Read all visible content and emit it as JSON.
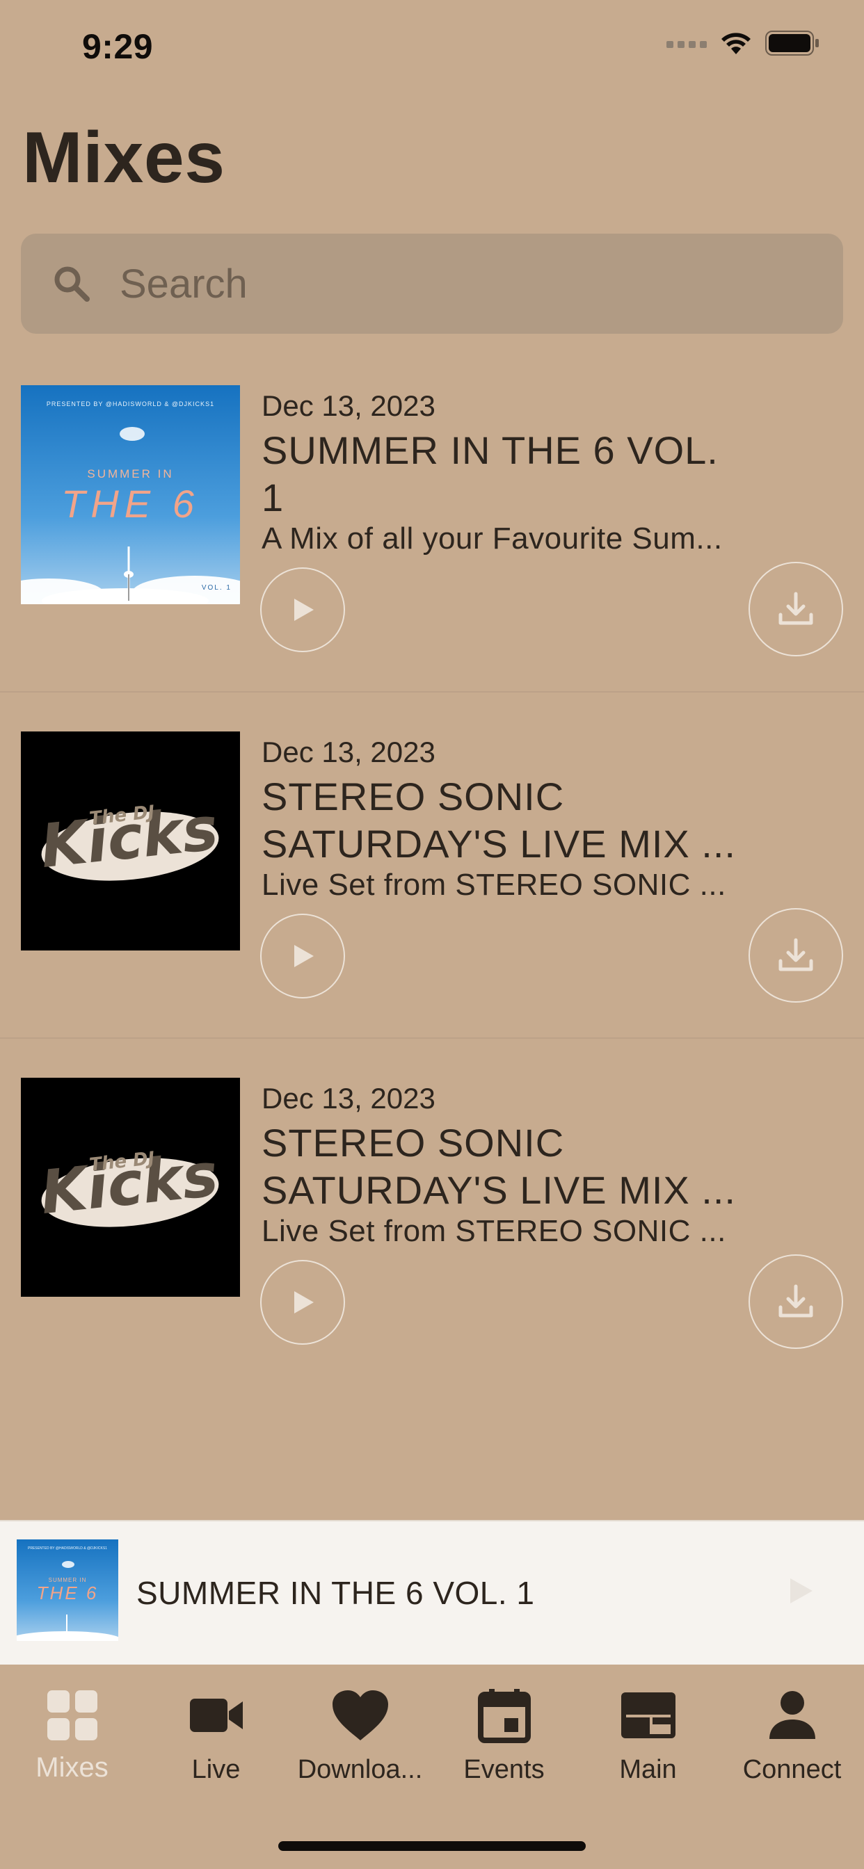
{
  "status_bar": {
    "time": "9:29"
  },
  "page_title": "Mixes",
  "search": {
    "placeholder": "Search"
  },
  "mixes": [
    {
      "date": "Dec 13, 2023",
      "title": "SUMMER IN THE 6 VOL. 1",
      "description": "A Mix of all your Favourite Sum...",
      "cover": {
        "type": "summer",
        "top_text": "PRESENTED BY @HADISWORLD & @DJKICKS1",
        "line1": "SUMMER IN",
        "line2": "THE 6",
        "vol": "VOL. 1"
      }
    },
    {
      "date": "Dec 13, 2023",
      "title": "STEREO SONIC SATURDAY'S LIVE MIX ...",
      "description": "Live Set from STEREO SONIC ...",
      "cover": {
        "type": "dj",
        "small": "The DJ",
        "big": "Kicks"
      }
    },
    {
      "date": "Dec 13, 2023",
      "title": "STEREO SONIC SATURDAY'S LIVE MIX ...",
      "description": "Live Set from STEREO SONIC ...",
      "cover": {
        "type": "dj",
        "small": "The DJ",
        "big": "Kicks"
      }
    }
  ],
  "mini_player": {
    "title": "SUMMER IN THE 6 VOL. 1",
    "cover": {
      "top_text": "PRESENTED BY @HADISWORLD & @DJKICKS1",
      "line1": "SUMMER IN",
      "line2": "THE 6"
    }
  },
  "tabs": [
    {
      "label": "Mixes",
      "icon": "grid-icon",
      "active": true
    },
    {
      "label": "Live",
      "icon": "video-camera-icon",
      "active": false
    },
    {
      "label": "Downloa...",
      "icon": "heart-icon",
      "active": false
    },
    {
      "label": "Events",
      "icon": "calendar-icon",
      "active": false
    },
    {
      "label": "Main",
      "icon": "browser-window-icon",
      "active": false
    },
    {
      "label": "Connect",
      "icon": "person-icon",
      "active": false
    }
  ],
  "colors": {
    "background": "#c7ab8f",
    "text": "#2d251e",
    "accent_light": "#ece2d7",
    "search_bg": "#b19b84",
    "mini_player_bg": "#f6f3ef"
  }
}
